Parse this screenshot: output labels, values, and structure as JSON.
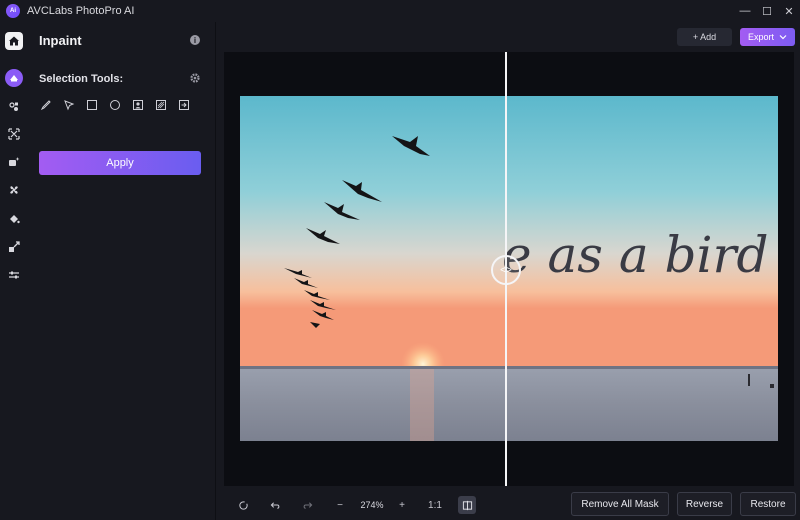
{
  "app": {
    "title": "AVCLabs PhotoPro AI",
    "logo_text": "Ai"
  },
  "window": {
    "minimize": "—",
    "restore": "☐",
    "close": "✕"
  },
  "panel": {
    "title": "Inpaint",
    "selection_label": "Selection Tools:",
    "apply_label": "Apply"
  },
  "toolbar": {
    "add_label": "+ Add",
    "export_label": "Export"
  },
  "photo": {
    "overlay_text": "e as a bird"
  },
  "bottom": {
    "zoom": "274%",
    "ratio": "1:1",
    "remove_all_mask": "Remove All Mask",
    "reverse": "Reverse",
    "restore": "Restore"
  },
  "colors": {
    "accent": "#8b5cf6",
    "accent_end": "#6a5df0",
    "bg": "#17181f",
    "canvas": "#0c0d12"
  }
}
